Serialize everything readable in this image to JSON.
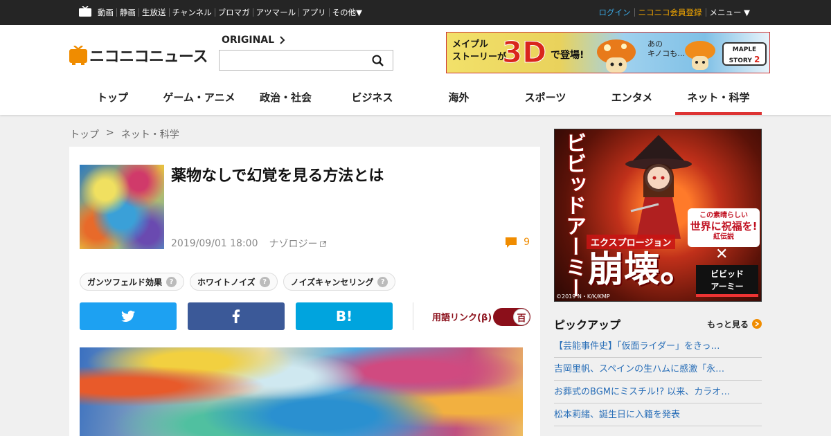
{
  "topbar": {
    "nav": [
      "動画",
      "静画",
      "生放送",
      "チャンネル",
      "ブロマガ",
      "アツマール",
      "アプリ",
      "その他▼"
    ],
    "login": "ログイン",
    "register": "ニコニコ会員登録",
    "menu": "メニュー ▼"
  },
  "header": {
    "logo_text": "ニコニコニュース",
    "original_label": "ORIGINAL",
    "search_placeholder": "",
    "categories": [
      "トップ",
      "ゲーム・アニメ",
      "政治・社会",
      "ビジネス",
      "海外",
      "スポーツ",
      "エンタメ",
      "ネット・科学"
    ],
    "active_category": "ネット・科学"
  },
  "banner_ad": {
    "line1": "メイプル",
    "line2": "ストーリーが",
    "big": "3D",
    "suffix": "で登場!",
    "speech1": "あの",
    "speech2": "キノコも…",
    "logo1": "MAPLE",
    "logo2": "STORY",
    "logo3": "2"
  },
  "breadcrumb": {
    "home": "トップ",
    "separator": ">",
    "current": "ネット・科学"
  },
  "article": {
    "title": "薬物なしで幻覚を見る方法とは",
    "date": "2019/09/01 18:00",
    "source": "ナゾロジー",
    "comment_count": "9",
    "tags": [
      "ガンツフェルド効果",
      "ホワイトノイズ",
      "ノイズキャンセリング"
    ],
    "tag_help": "?",
    "share": {
      "hatena": "B!"
    },
    "term_link_label": "用語リンク(β)",
    "term_toggle": "百"
  },
  "side_ad": {
    "vertical": "ビビッドアーミー",
    "explosion": "エクスプロージョン",
    "collapse": "崩壊。",
    "badge_small": "この素晴らしい",
    "badge_big": "世界に祝福を!",
    "badge_sub": "紅伝説",
    "cross": "✕",
    "vivid1": "ビビッド",
    "vivid2": "アーミー",
    "copyright": "©2019 N・K/K/KMP"
  },
  "pickup": {
    "title": "ピックアップ",
    "more": "もっと見る",
    "items": [
      "【芸能事件史】「仮面ライダー」をきっ…",
      "吉岡里帆、スペインの生ハムに感激「永…",
      "お葬式のBGMにミスチル!? 以来、カラオ…",
      "松本莉緒、誕生日に入籍を発表"
    ]
  },
  "colors": {
    "accent_red": "#dd3333",
    "twitter": "#1da1f2",
    "facebook": "#3b5998",
    "hatena": "#00a4de",
    "link_blue": "#2a6fb8",
    "comment_orange": "#f08c00"
  }
}
